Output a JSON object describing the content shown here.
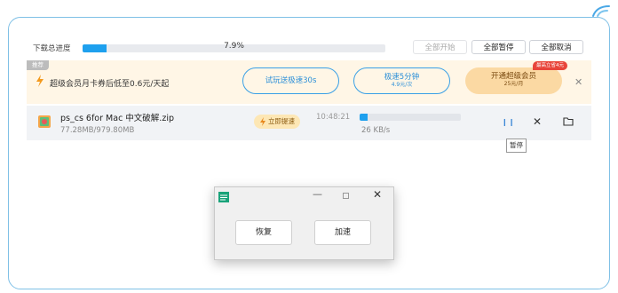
{
  "header": {
    "progress_label": "下载总进度",
    "progress_percent": "7.9%",
    "progress_fraction": 0.079,
    "speed": "26 KB/s",
    "start_all": "全部开始",
    "pause_all": "全部暂停",
    "cancel_all": "全部取消"
  },
  "promo": {
    "tag": "推荐",
    "text": "超级会员月卡券后低至0.6元/天起",
    "trial_label": "试玩送极速30s",
    "speed_label": "极速5分钟",
    "speed_sub": "4.9元/次",
    "vip_label": "开通超级会员",
    "vip_sub": "25元/月",
    "vip_badge": "最高立省4元"
  },
  "task": {
    "file_name": "ps_cs 6for Mac 中文破解.zip",
    "file_size": "77.28MB/979.80MB",
    "boost_label": "立即提速",
    "time": "10:48:21",
    "speed": "26 KB/s",
    "progress_fraction": 0.079,
    "pause_tooltip": "暂停"
  },
  "dialog": {
    "resume_label": "恢复",
    "speedup_label": "加速"
  },
  "colors": {
    "accent": "#1ea0ee",
    "promo_bg": "#fff6e6",
    "vip_bg": "#fbd9a3",
    "badge": "#e8453a"
  }
}
